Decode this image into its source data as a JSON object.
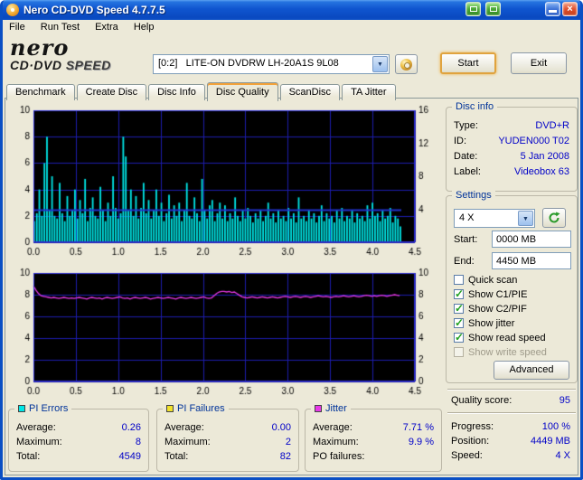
{
  "window": {
    "title": "Nero CD-DVD Speed 4.7.7.5",
    "menu": [
      {
        "label": "File"
      },
      {
        "label": "Run Test"
      },
      {
        "label": "Extra"
      },
      {
        "label": "Help"
      }
    ]
  },
  "logo": {
    "brand": "nero",
    "product": "CD·DVD",
    "speed": "SPEED"
  },
  "toolbar": {
    "drive_value": "[0:2]   LITE-ON DVDRW LH-20A1S 9L08",
    "start_label": "Start",
    "exit_label": "Exit"
  },
  "tabs": [
    {
      "label": "Benchmark"
    },
    {
      "label": "Create Disc"
    },
    {
      "label": "Disc Info"
    },
    {
      "label": "Disc Quality"
    },
    {
      "label": "ScanDisc"
    },
    {
      "label": "TA Jitter"
    }
  ],
  "disc_info": {
    "title": "Disc info",
    "rows": [
      {
        "label": "Type:",
        "value": "DVD+R"
      },
      {
        "label": "ID:",
        "value": "YUDEN000 T02"
      },
      {
        "label": "Date:",
        "value": "5 Jan 2008"
      },
      {
        "label": "Label:",
        "value": "Videobox 63"
      }
    ]
  },
  "settings": {
    "title": "Settings",
    "speed_value": "4 X",
    "start_label": "Start:",
    "start_value": "0000 MB",
    "end_label": "End:",
    "end_value": "4450 MB",
    "checkboxes": [
      {
        "label": "Quick scan",
        "checked": false,
        "disabled": false
      },
      {
        "label": "Show C1/PIE",
        "checked": true,
        "disabled": false
      },
      {
        "label": "Show C2/PIF",
        "checked": true,
        "disabled": false
      },
      {
        "label": "Show jitter",
        "checked": true,
        "disabled": false
      },
      {
        "label": "Show read speed",
        "checked": true,
        "disabled": false
      },
      {
        "label": "Show write speed",
        "checked": false,
        "disabled": true
      }
    ],
    "advanced_label": "Advanced"
  },
  "quality": {
    "label": "Quality score:",
    "value": "95"
  },
  "status": {
    "rows": [
      {
        "label": "Progress:",
        "value": "100 %"
      },
      {
        "label": "Position:",
        "value": "4449 MB"
      },
      {
        "label": "Speed:",
        "value": "4 X"
      }
    ]
  },
  "stat_panels": [
    {
      "title": "PI Errors",
      "chip": "#00e6e6",
      "rows": [
        {
          "label": "Average:",
          "value": "0.26"
        },
        {
          "label": "Maximum:",
          "value": "8"
        },
        {
          "label": "Total:",
          "value": "4549"
        }
      ]
    },
    {
      "title": "PI Failures",
      "chip": "#f2e22a",
      "rows": [
        {
          "label": "Average:",
          "value": "0.00"
        },
        {
          "label": "Maximum:",
          "value": "2"
        },
        {
          "label": "Total:",
          "value": "82"
        }
      ]
    },
    {
      "title": "Jitter",
      "chip": "#e838e8",
      "rows": [
        {
          "label": "Average:",
          "value": "7.71 %"
        },
        {
          "label": "Maximum:",
          "value": "9.9 %"
        },
        {
          "label": "PO failures:",
          "value": ""
        }
      ]
    }
  ],
  "chart_data": [
    {
      "type": "bar",
      "name": "PI Errors vs position",
      "x_unit": "GB",
      "x_ticks": [
        "0.0",
        "0.5",
        "1.0",
        "1.5",
        "2.0",
        "2.5",
        "3.0",
        "3.5",
        "4.0",
        "4.5"
      ],
      "xmax": 4.5,
      "ymax": 10,
      "left_ticks": [
        "10",
        "8",
        "6",
        "4",
        "2",
        "0"
      ],
      "right_ticks": [
        "16",
        "12",
        "8",
        "4"
      ],
      "right_max": 16,
      "bg_color": "#000000",
      "grid_color": "#1c1cae",
      "border_color": "#2e2ed8",
      "bar_color": "#00e6e6",
      "step_x": 0.03,
      "read_speed_line": {
        "color": "#2233cc",
        "right_axis_value": 4,
        "start_x": 0,
        "end_x": 4.34
      },
      "values": [
        1.6,
        2.2,
        4.0,
        2.0,
        6.0,
        8.0,
        2.4,
        5.0,
        2.0,
        1.8,
        4.5,
        2.2,
        1.6,
        3.5,
        2.0,
        2.4,
        4.0,
        1.8,
        3.2,
        2.2,
        4.8,
        1.6,
        2.6,
        3.4,
        2.0,
        1.8,
        4.2,
        2.4,
        1.6,
        3.0,
        2.0,
        5.0,
        2.6,
        1.8,
        2.2,
        8.0,
        6.5,
        2.4,
        4.0,
        2.0,
        3.5,
        1.8,
        2.6,
        4.5,
        2.2,
        3.2,
        1.8,
        2.4,
        4.0,
        2.0,
        3.0,
        1.6,
        2.2,
        3.6,
        1.8,
        2.8,
        2.0,
        3.0,
        1.6,
        2.4,
        4.5,
        2.0,
        1.8,
        3.4,
        2.2,
        1.6,
        4.8,
        2.4,
        1.8,
        2.8,
        3.2,
        1.6,
        2.2,
        3.0,
        1.8,
        2.8,
        1.6,
        2.2,
        1.8,
        3.4,
        2.0,
        1.6,
        2.4,
        1.8,
        2.6,
        2.0,
        1.5,
        2.2,
        1.8,
        2.4,
        1.6,
        2.0,
        3.0,
        1.8,
        2.2,
        1.5,
        2.4,
        1.8,
        2.0,
        1.6,
        2.6,
        1.8,
        2.2,
        1.5,
        3.4,
        1.8,
        2.0,
        1.6,
        2.4,
        1.8,
        2.2,
        1.5,
        2.0,
        2.8,
        1.6,
        2.2,
        1.8,
        2.0,
        1.5,
        2.4,
        1.8,
        2.6,
        1.6,
        2.0,
        1.8,
        2.4,
        1.5,
        2.2,
        1.8,
        2.0,
        1.6,
        2.8,
        1.8,
        3.0,
        2.0,
        2.2,
        1.6,
        2.4,
        1.8,
        2.0,
        2.6,
        1.5,
        2.0,
        1.8,
        1.2
      ]
    },
    {
      "type": "line",
      "name": "Jitter % vs position",
      "x_unit": "GB",
      "x_ticks": [
        "0.0",
        "0.5",
        "1.0",
        "1.5",
        "2.0",
        "2.5",
        "3.0",
        "3.5",
        "4.0",
        "4.5"
      ],
      "xmax": 4.5,
      "ymax": 10,
      "left_ticks": [
        "10",
        "8",
        "6",
        "4",
        "2",
        "0"
      ],
      "right_ticks": [
        "10",
        "8",
        "6",
        "4",
        "2",
        "0"
      ],
      "right_max": 10,
      "bg_color": "#000000",
      "grid_color": "#1c1cae",
      "border_color": "#2e2ed8",
      "line_color": "#e838e8",
      "step_x": 0.03,
      "values": [
        8.8,
        8.4,
        8.1,
        7.9,
        7.85,
        7.8,
        7.75,
        7.7,
        7.75,
        7.7,
        7.65,
        7.7,
        7.75,
        7.7,
        7.65,
        7.7,
        7.65,
        7.7,
        7.75,
        7.7,
        7.65,
        7.6,
        7.7,
        7.75,
        7.7,
        7.65,
        7.7,
        7.6,
        7.7,
        7.75,
        7.7,
        7.65,
        7.7,
        7.75,
        7.8,
        7.7,
        7.65,
        7.7,
        7.6,
        7.7,
        7.75,
        7.7,
        7.65,
        7.7,
        7.75,
        7.7,
        7.6,
        7.65,
        7.7,
        7.75,
        7.7,
        7.65,
        7.7,
        7.75,
        7.7,
        7.65,
        7.6,
        7.7,
        7.75,
        7.7,
        7.65,
        7.7,
        7.75,
        7.7,
        7.65,
        7.7,
        7.75,
        7.8,
        7.7,
        7.65,
        7.7,
        7.9,
        8.1,
        8.25,
        8.3,
        8.3,
        8.25,
        8.3,
        8.2,
        8.25,
        8.1,
        7.95,
        7.8,
        7.75,
        7.7,
        7.75,
        7.8,
        7.75,
        7.7,
        7.75,
        7.8,
        7.75,
        7.7,
        7.75,
        7.8,
        7.75,
        7.7,
        7.75,
        7.8,
        7.85,
        7.8,
        7.75,
        7.8,
        7.85,
        7.8,
        7.75,
        7.8,
        7.85,
        7.8,
        7.75,
        7.8,
        7.85,
        7.9,
        7.85,
        7.8,
        7.85,
        7.8,
        7.75,
        7.8,
        7.85,
        7.8,
        7.85,
        7.9,
        7.85,
        7.8,
        7.85,
        7.9,
        7.85,
        7.8,
        7.85,
        7.9,
        7.95,
        7.9,
        7.85,
        7.9,
        7.85,
        7.9,
        7.95,
        7.9,
        7.85,
        7.9,
        7.95,
        8.0,
        7.95,
        7.9
      ]
    }
  ]
}
